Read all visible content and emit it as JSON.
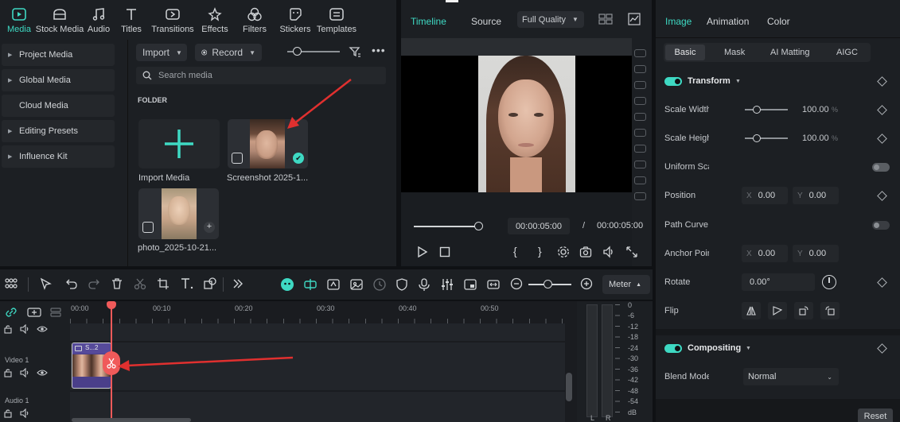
{
  "nav": {
    "items": [
      {
        "label": "Media",
        "icon": "media-icon",
        "active": true
      },
      {
        "label": "Stock Media",
        "icon": "stock-media-icon"
      },
      {
        "label": "Audio",
        "icon": "audio-icon"
      },
      {
        "label": "Titles",
        "icon": "titles-icon"
      },
      {
        "label": "Transitions",
        "icon": "transitions-icon"
      },
      {
        "label": "Effects",
        "icon": "effects-icon"
      },
      {
        "label": "Filters",
        "icon": "filters-icon"
      },
      {
        "label": "Stickers",
        "icon": "stickers-icon"
      },
      {
        "label": "Templates",
        "icon": "templates-icon"
      }
    ]
  },
  "sidebar": {
    "items": [
      {
        "label": "Project Media",
        "arrow": true
      },
      {
        "label": "Global Media",
        "arrow": true
      },
      {
        "label": "Cloud Media",
        "arrow": false
      },
      {
        "label": "Editing Presets",
        "arrow": true
      },
      {
        "label": "Influence Kit",
        "arrow": true
      }
    ]
  },
  "media": {
    "import_label": "Import",
    "record_label": "Record",
    "search_placeholder": "Search media",
    "folder_label": "FOLDER",
    "import_media_label": "Import Media",
    "item1_caption": "Screenshot 2025-1...",
    "item2_caption": "photo_2025-10-21..."
  },
  "preview": {
    "tab_timeline": "Timeline",
    "tab_source": "Source",
    "quality": "Full Quality",
    "current_time": "00:00:05:00",
    "separator": "/",
    "total_time": "00:00:05:00",
    "bracket_in": "{",
    "bracket_out": "}"
  },
  "inspector": {
    "tabs": [
      "Image",
      "Animation",
      "Color"
    ],
    "subtabs": [
      "Basic",
      "Mask",
      "AI Matting",
      "AIGC"
    ],
    "transform_label": "Transform",
    "scale_width_label": "Scale Width",
    "scale_width_value": "100.00",
    "scale_height_label": "Scale Height",
    "scale_height_value": "100.00",
    "percent": "%",
    "uniform_scale_label": "Uniform Scale",
    "position_label": "Position",
    "pos_x_prefix": "X",
    "pos_x": "0.00",
    "pos_y_prefix": "Y",
    "pos_y": "0.00",
    "path_curve_label": "Path Curve",
    "anchor_label": "Anchor Point",
    "anchor_x": "0.00",
    "anchor_y": "0.00",
    "rotate_label": "Rotate",
    "rotate_value": "0.00°",
    "flip_label": "Flip",
    "compositing_label": "Compositing",
    "blend_mode_label": "Blend Mode",
    "blend_mode_value": "Normal",
    "reset_label": "Reset"
  },
  "toolbar": {
    "meter_label": "Meter",
    "meter_caret": "▲"
  },
  "timeline": {
    "ruler": [
      "00:00",
      "00:10",
      "00:20",
      "00:30",
      "00:40",
      "00:50"
    ],
    "video_track_label": "Video 1",
    "audio_track_label": "Audio 1",
    "clip_label": "S...2",
    "meter_scale": [
      "0",
      "-6",
      "-12",
      "-18",
      "-24",
      "-30",
      "-36",
      "-42",
      "-48",
      "-54",
      "dB"
    ],
    "meter_lr": [
      "L",
      "R"
    ]
  },
  "colors": {
    "accent": "#3ed9c3",
    "annotation_arrow": "#e0302f",
    "playhead": "#f05a5a",
    "clip": "#4a3f8a"
  }
}
